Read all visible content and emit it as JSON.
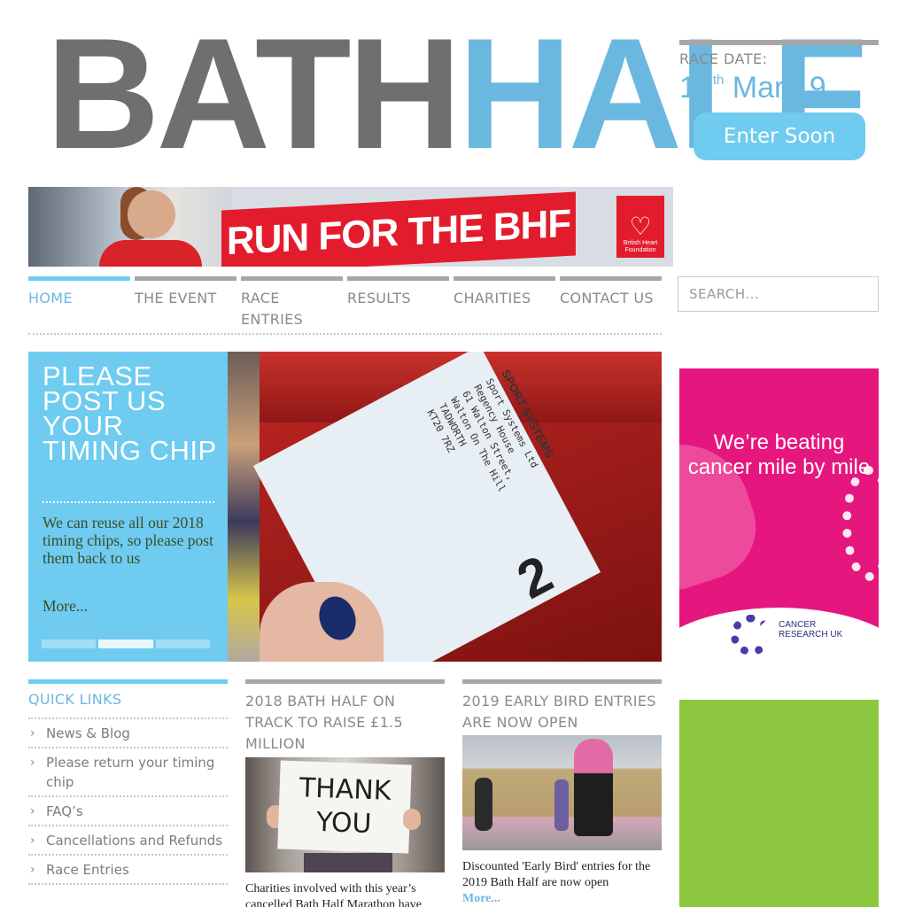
{
  "logo": {
    "part1": "BATH",
    "part2": "HALF"
  },
  "race": {
    "label": "RACE DATE:",
    "day": "17",
    "suffix": "th",
    "rest": "Mar 19",
    "button": "Enter Soon"
  },
  "banner": {
    "headline": "RUN FOR THE BHF",
    "logo_text_1": "British Heart",
    "logo_text_2": "Foundation"
  },
  "nav": {
    "items": [
      {
        "label": "HOME"
      },
      {
        "label": "THE EVENT"
      },
      {
        "label": "RACE ENTRIES"
      },
      {
        "label": "RESULTS"
      },
      {
        "label": "CHARITIES"
      },
      {
        "label": "CONTACT US"
      }
    ],
    "active_index": 0
  },
  "search": {
    "placeholder": "SEARCH..."
  },
  "hero": {
    "title": "PLEASE POST US YOUR TIMING CHIP",
    "text": "We can reuse all our 2018 timing chips, so please post them back to us",
    "more": "More...",
    "slides": 3,
    "active_slide": 1,
    "image_text": "Sport Systems Ltd\nRegency House\n61 Walton Street,\nWalton On The Hill\nTADWORTH\nKT20 7RZ",
    "image_brand": "SPORT SYSTEMS",
    "image_number": "2"
  },
  "ad_cr": {
    "headline": "We’re beating cancer mile by mile",
    "logo_text": "CANCER RESEARCH UK"
  },
  "quick_links": {
    "title": "QUICK LINKS",
    "items": [
      {
        "label": "News & Blog"
      },
      {
        "label": "Please return your timing chip"
      },
      {
        "label": "FAQ’s"
      },
      {
        "label": "Cancellations and Refunds"
      },
      {
        "label": "Race Entries"
      }
    ]
  },
  "news": [
    {
      "title": "2018 BATH HALF ON TRACK TO RAISE £1.5 MILLION",
      "image_text_1": "THANK",
      "image_text_2": "YOU",
      "text": "Charities involved with this year’s cancelled Bath Half Marathon have"
    },
    {
      "title": "2019 EARLY BIRD ENTRIES ARE NOW OPEN",
      "text": "Discounted 'Early Bird' entries for the 2019 Bath Half are now open",
      "more": "More..."
    }
  ],
  "colors": {
    "accent_blue": "#6fcbf0",
    "logo_grey": "#6f6f6f",
    "bhf_red": "#e31c2d",
    "cancer_research_pink": "#e5167e",
    "green": "#8dc63f"
  }
}
